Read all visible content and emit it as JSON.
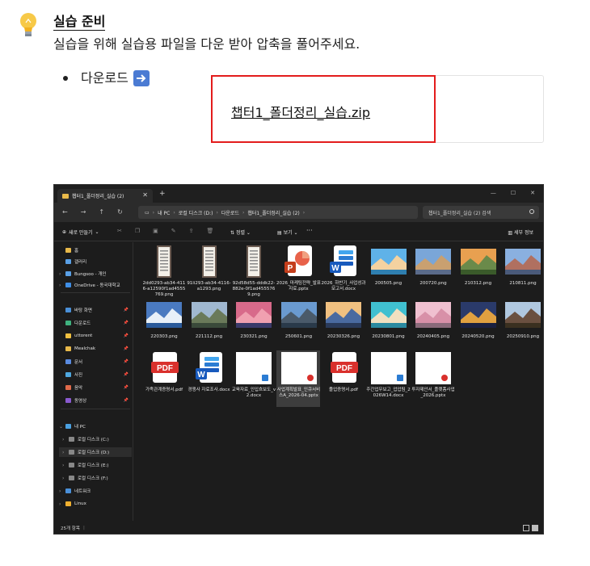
{
  "header": {
    "title": "실습 준비",
    "description": "실습을 위해 실습용 파일을 다운 받아 압축을 풀어주세요."
  },
  "download": {
    "label": "다운로드",
    "file_name": "챕터1_폴더정리_실습.zip",
    "highlight_color": "#e31c1c"
  },
  "explorer": {
    "tab_title": "챕터1_폴더정리_실습 (2)",
    "address": [
      "내 PC",
      "로컬 디스크 (D:)",
      "다운로드",
      "챕터1_폴더정리_실습 (2)"
    ],
    "search_placeholder": "챕터1_폴더정리_실습 (2) 검색",
    "toolbar": {
      "new": "새로 만들기",
      "sort": "정렬",
      "view": "보기",
      "more": "···",
      "details": "세부 정보"
    },
    "sidebar": [
      {
        "label": "홈",
        "icon": "home-icon"
      },
      {
        "label": "갤러리",
        "icon": "gallery-icon"
      },
      {
        "label": "Bungsoo - 개인",
        "icon": "cloud-icon"
      },
      {
        "label": "OneDrive - 동국대학교",
        "icon": "cloud-icon"
      },
      {
        "label": "바탕 화면",
        "icon": "desktop-icon"
      },
      {
        "label": "다운로드",
        "icon": "download-icon"
      },
      {
        "label": "uttorent",
        "icon": "star-icon"
      },
      {
        "label": "Mealchak",
        "icon": "folder-icon"
      },
      {
        "label": "문서",
        "icon": "document-icon"
      },
      {
        "label": "사진",
        "icon": "picture-icon"
      },
      {
        "label": "음악",
        "icon": "music-icon"
      },
      {
        "label": "동영상",
        "icon": "video-icon"
      },
      {
        "label": "내 PC",
        "icon": "pc-icon"
      },
      {
        "label": "로컬 디스크 (C:)",
        "icon": "drive-icon"
      },
      {
        "label": "로컬 디스크 (D:)",
        "icon": "drive-icon"
      },
      {
        "label": "로컬 디스크 (E:)",
        "icon": "drive-icon"
      },
      {
        "label": "로컬 디스크 (F:)",
        "icon": "drive-icon"
      },
      {
        "label": "네트워크",
        "icon": "network-icon"
      },
      {
        "label": "Linux",
        "icon": "linux-icon"
      }
    ],
    "files": [
      {
        "name": "2dd0293-ab34-4116-a12590f1ad4555769.png",
        "kind": "receipt"
      },
      {
        "name": "91li293-ab34-4116-a1293.png",
        "kind": "receipt"
      },
      {
        "name": "92d58d55-dddk22-882e-0f1ad4555769.png",
        "kind": "receipt"
      },
      {
        "name": "2026_마케팅전략_발표자료.pptx",
        "kind": "pptx"
      },
      {
        "name": "2026_하반기_사업성과보고서.docx",
        "kind": "docx"
      },
      {
        "name": "200505.png",
        "kind": "photo"
      },
      {
        "name": "200720.png",
        "kind": "photo"
      },
      {
        "name": "210312.png",
        "kind": "photo"
      },
      {
        "name": "210811.png",
        "kind": "photo"
      },
      {
        "name": "220303.png",
        "kind": "photo"
      },
      {
        "name": "221112.png",
        "kind": "photo"
      },
      {
        "name": "230321.png",
        "kind": "photo"
      },
      {
        "name": "250601.png",
        "kind": "photo"
      },
      {
        "name": "20230326.png",
        "kind": "photo"
      },
      {
        "name": "20230801.png",
        "kind": "photo"
      },
      {
        "name": "20240405.png",
        "kind": "photo"
      },
      {
        "name": "20240520.png",
        "kind": "photo"
      },
      {
        "name": "20250910.png",
        "kind": "photo"
      },
      {
        "name": "가족관계증명서.pdf",
        "kind": "pdf"
      },
      {
        "name": "경쟁사 자료조사.docx",
        "kind": "docx"
      },
      {
        "name": "교육자료_인입흐보도_v2.docx",
        "kind": "blank-docx"
      },
      {
        "name": "사업계획발표_인큐서비스A_2026-04.pptx",
        "kind": "blank-pptx"
      },
      {
        "name": "졸업증명서.pdf",
        "kind": "pdf"
      },
      {
        "name": "주간업무보고_업업팀_2026W14.docx",
        "kind": "blank-docx"
      },
      {
        "name": "투자제안서_플랫폼사업_2026.pptx",
        "kind": "blank-pptx"
      }
    ],
    "status": "25개 항목"
  }
}
